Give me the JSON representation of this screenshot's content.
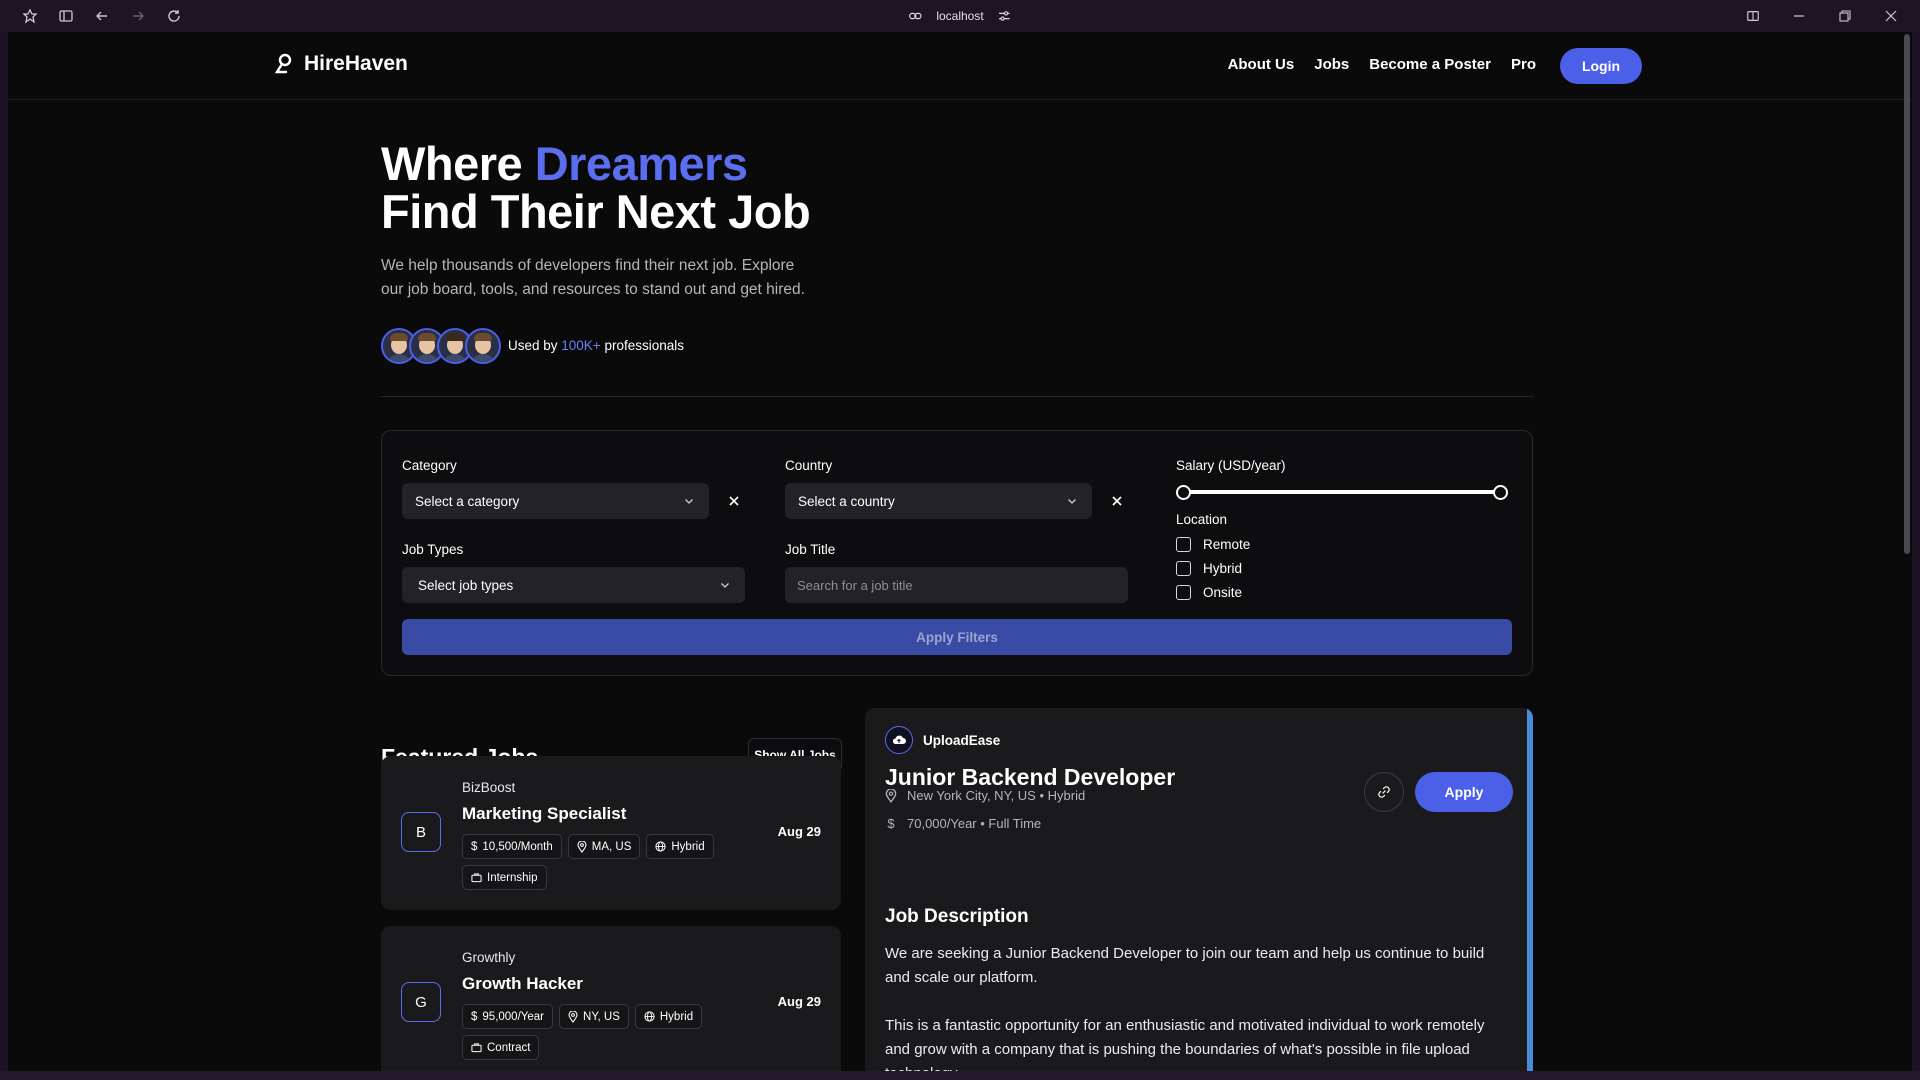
{
  "browser": {
    "url": "localhost"
  },
  "nav": {
    "brand": "HireHaven",
    "links": [
      "About Us",
      "Jobs",
      "Become a Poster",
      "Pro"
    ],
    "login_label": "Login"
  },
  "hero": {
    "title_prefix": "Where ",
    "title_accent": "Dreamers",
    "title_line2": "Find Their Next Job",
    "subtitle": "We help thousands of developers find their next job. Explore our job board, tools, and resources to stand out and get hired.",
    "used_by_prefix": "Used by ",
    "used_by_count": "100K+",
    "used_by_suffix": " professionals"
  },
  "filters": {
    "category_label": "Category",
    "category_value": "Select a category",
    "country_label": "Country",
    "country_value": "Select a country",
    "job_types_label": "Job Types",
    "job_types_value": "Select job types",
    "job_title_label": "Job Title",
    "job_title_placeholder": "Search for a job title",
    "salary_label": "Salary (USD/year)",
    "salary_range_fraction": [
      0,
      1
    ],
    "location_label": "Location",
    "location_options": [
      "Remote",
      "Hybrid",
      "Onsite"
    ],
    "apply_label": "Apply Filters"
  },
  "featured": {
    "title": "Featured Jobs",
    "show_all_label": "Show All Jobs",
    "jobs": [
      {
        "initial": "B",
        "company": "BizBoost",
        "title": "Marketing Specialist",
        "salary": "10,500/Month",
        "location": "MA, US",
        "mode": "Hybrid",
        "type": "Internship",
        "date": "Aug 29"
      },
      {
        "initial": "G",
        "company": "Growthly",
        "title": "Growth Hacker",
        "salary": "95,000/Year",
        "location": "NY, US",
        "mode": "Hybrid",
        "type": "Contract",
        "date": "Aug 29"
      }
    ]
  },
  "detail": {
    "company": "UploadEase",
    "title": "Junior Backend Developer",
    "location_line": "New York City, NY, US • Hybrid",
    "salary_line": "70,000/Year • Full Time",
    "apply_label": "Apply",
    "desc_title": "Job Description",
    "desc_p1": "We are seeking a Junior Backend Developer to join our team and help us continue to build and scale our platform.",
    "desc_p2": "This is a fantastic opportunity for an enthusiastic and motivated individual to work remotely and grow with a company that is pushing the boundaries of what's possible in file upload technology."
  },
  "colors": {
    "accent": "#5b6ef0",
    "button": "#4b5fe8",
    "background": "#0a0a0b",
    "card": "#1a1a1d"
  }
}
